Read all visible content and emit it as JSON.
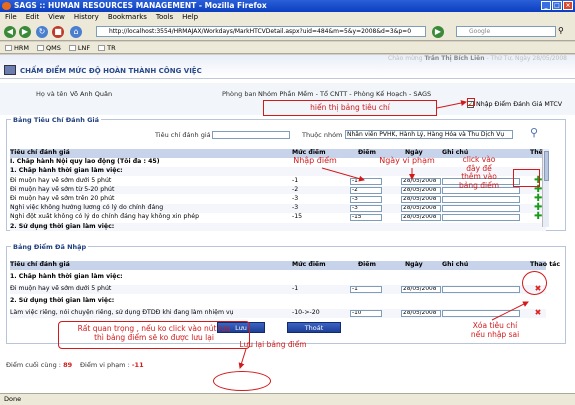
{
  "window": {
    "title": "SAGS :: HUMAN RESOURCES MANAGEMENT - Mozilla Firefox",
    "buttons": [
      "_",
      "□",
      "×"
    ]
  },
  "menu": [
    "File",
    "Edit",
    "View",
    "History",
    "Bookmarks",
    "Tools",
    "Help"
  ],
  "nav": {
    "url": "http://localhost:3554/HRMAJAX/Workdays/MarkHTCVDetail.aspx?uid=484&m=5&y=2008&d=3&p=0",
    "search_placeholder": "Google"
  },
  "bookmarks": [
    "HRM",
    "QMS",
    "LNF",
    "TR"
  ],
  "header": {
    "welcome_prefix": "Chào mừng",
    "welcome_name": "Trần Thị Bích Liên",
    "welcome_date": "- Thứ Tư, Ngày 28/05/2008",
    "title": "CHẤM ĐIỂM MỨC ĐỘ HOÀN THÀNH CÔNG VIỆC"
  },
  "info": {
    "name_label": "Họ và tên",
    "name_value": "Võ Anh Quân",
    "dept_label": "Phòng ban",
    "dept_value": "Nhóm Phần Mềm - Tổ CNTT - Phòng Kế Hoạch - SAGS",
    "checkbox_label": "Nhập Điểm Đánh Giá MTCV",
    "checkbox_mark": "✓"
  },
  "criteria": {
    "section_title": "Bảng Tiêu Chí Đánh Giá",
    "filter_label": "Tiêu chí đánh giá",
    "group_label": "Thuộc nhóm",
    "group_value": "Nhân viên PVHK, Hành Lý, Hàng Hóa và Thu Dịch Vụ",
    "columns": [
      "Tiêu chí đánh giá",
      "Mức điểm",
      "Điểm",
      "Ngày",
      "Ghi chú",
      "Thêm"
    ],
    "rows": [
      {
        "name": "I. Chấp hành Nội quy lao động (Tối đa : 45)",
        "score": "",
        "point": "",
        "date": "",
        "bold": true
      },
      {
        "name": "1. Chấp hành thời gian làm việc:",
        "score": "",
        "point": "",
        "date": "",
        "bold": true
      },
      {
        "name": "Đi muộn hay về sớm dưới 5 phút",
        "score": "-1",
        "point": "-1",
        "date": "28/05/2008"
      },
      {
        "name": "Đi muộn hay về sớm từ 5-20 phút",
        "score": "-2",
        "point": "-2",
        "date": "28/05/2008"
      },
      {
        "name": "Đi muộn hay về sớm trên 20 phút",
        "score": "-3",
        "point": "-3",
        "date": "28/05/2008"
      },
      {
        "name": "Nghỉ việc không hưởng lương có lý do chính đáng",
        "score": "-3",
        "point": "-3",
        "date": "28/05/2008"
      },
      {
        "name": "Nghỉ đột xuất không có lý do chính đáng hay không xin phép",
        "score": "-15",
        "point": "-15",
        "date": "28/05/2008"
      },
      {
        "name": "2. Sử dụng thời gian làm việc:",
        "score": "",
        "point": "",
        "date": "",
        "bold": true
      }
    ]
  },
  "entered": {
    "section_title": "Bảng Điểm Đã Nhập",
    "columns": [
      "Tiêu chí đánh giá",
      "Mức điểm",
      "Điểm",
      "Ngày",
      "Ghi chú",
      "Thao tác"
    ],
    "rows": [
      {
        "name": "1. Chấp hành thời gian làm việc:",
        "score": "",
        "point": "",
        "date": "",
        "bold": true
      },
      {
        "name": "Đi muộn hay về sớm dưới 5 phút",
        "score": "-1",
        "point": "-1",
        "date": "28/05/2008"
      },
      {
        "name": "2. Sử dụng thời gian làm việc:",
        "score": "",
        "point": "",
        "date": "",
        "bold": true
      },
      {
        "name": "Làm việc riêng, nói chuyện riêng, sử dụng ĐTDĐ khi đang làm nhiệm vụ",
        "score": "-10->-20",
        "point": "-10",
        "date": "28/05/2008"
      }
    ]
  },
  "summary": {
    "final_label": "Điểm cuối cùng :",
    "final_value": "89",
    "violation_label": "Điểm vi phạm :",
    "violation_value": "-11"
  },
  "buttons": {
    "save": "Lưu",
    "exit": "Thoát"
  },
  "status": "Done",
  "annotations": {
    "show_criteria": "hiển thị bảng tiêu chí",
    "enter_score": "Nhập điểm",
    "violation_date": "Ngày vi phạm",
    "click_add": "click vào\nđây để\nthêm vào\nbảng điểm",
    "important": "Rất quan trọng , nếu ko click vào nút lưu\nthì bảng điểm sẽ ko được lưu lại",
    "save_table": "Lưu lại bảng điểm",
    "delete_wrong": "Xóa tiêu chí\nnếu nhập sai"
  },
  "colors": {
    "annotation": "#d21a1a",
    "header": "#c6d3ea",
    "add": "#1a9a1a"
  }
}
